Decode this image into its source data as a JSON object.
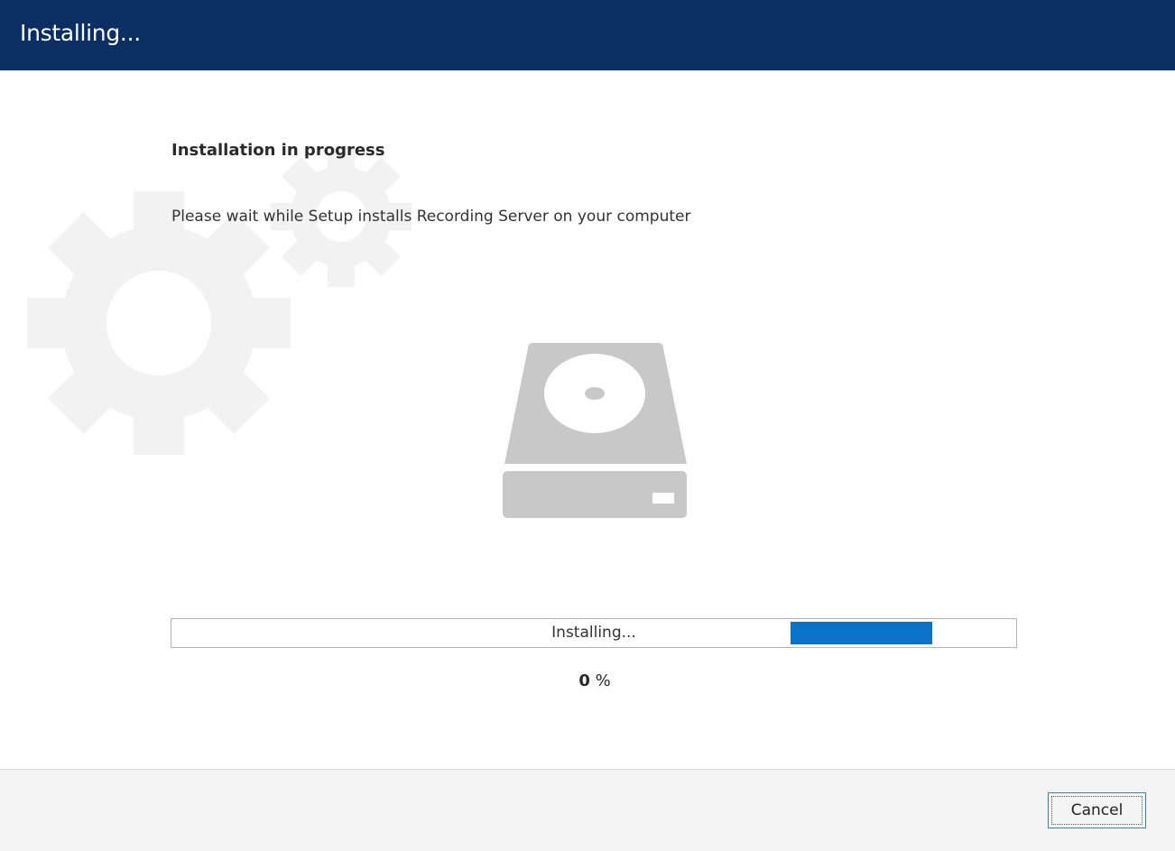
{
  "window": {
    "title": "Installing..."
  },
  "main": {
    "heading": "Installation in progress",
    "description": "Please wait while Setup installs Recording Server on your computer"
  },
  "progress": {
    "label": "Installing...",
    "percent_value": "0",
    "percent_sign": "%",
    "bar_color": "#0a72c8"
  },
  "footer": {
    "cancel_label": "Cancel"
  },
  "colors": {
    "title_bar": "#0b2f63",
    "icon_gray": "#c8c8c8",
    "gear_watermark": "#f2f2f2"
  },
  "icons": {
    "background": "gears-icon",
    "center": "hard-drive-icon"
  }
}
